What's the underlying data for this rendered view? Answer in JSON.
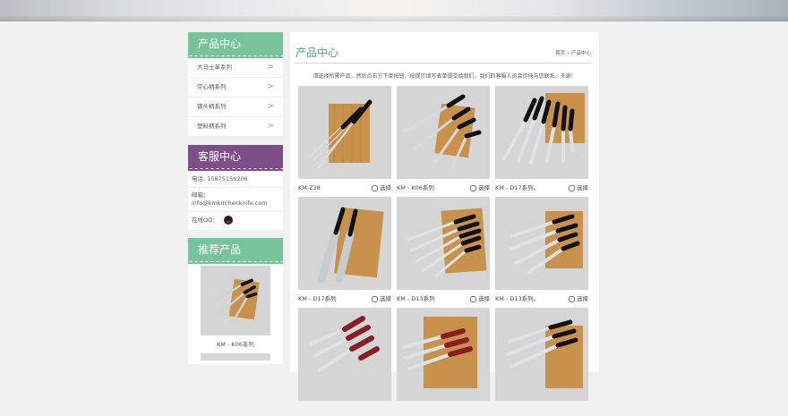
{
  "sidebar": {
    "products": {
      "title": "产品中心",
      "items": [
        {
          "label": "大马士革系列"
        },
        {
          "label": "空心柄系列"
        },
        {
          "label": "钢头柄系列"
        },
        {
          "label": "塑料柄系列"
        }
      ]
    },
    "service": {
      "title": "客服中心",
      "phone": "电话: 15875156206",
      "email_label": "邮箱：",
      "email": "info@kmkitchenknife.com",
      "qq_label": "在线QQ："
    },
    "recommend": {
      "title": "推荐产品",
      "item_caption": "KM - K06系列"
    }
  },
  "main": {
    "title": "产品中心",
    "breadcrumb": "首页 » 产品中心",
    "notice": "请选择所需产品，然后点右方下单按钮，按提示填写表单提交给我们，我们的客服人员会尽快与您联系。多谢！",
    "select_label": "选择",
    "products": [
      {
        "name": "KM-Z38"
      },
      {
        "name": "KM - K06系列"
      },
      {
        "name": "KM - D17系列。"
      },
      {
        "name": "KM - D17系列"
      },
      {
        "name": "KM - D13系列"
      },
      {
        "name": "KM - D13系列。"
      },
      {
        "name": ""
      },
      {
        "name": ""
      },
      {
        "name": ""
      }
    ]
  },
  "colors": {
    "green_header": "#79c39b",
    "purple_header": "#7c4f88",
    "title_green": "#4aa575",
    "board_wood": "#c8914c"
  }
}
